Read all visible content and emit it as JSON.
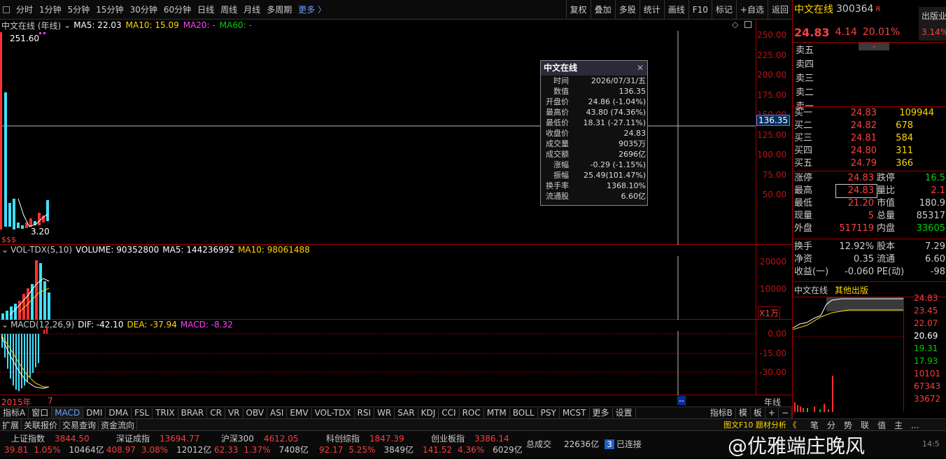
{
  "toolbar": {
    "periods": [
      "分时",
      "1分钟",
      "5分钟",
      "15分钟",
      "30分钟",
      "60分钟",
      "日线",
      "周线",
      "月线",
      "多周期"
    ],
    "more": "更多 〉",
    "right_buttons": [
      "复权",
      "叠加",
      "多股",
      "统计",
      "画线",
      "F10",
      "标记",
      "+自选",
      "返回"
    ]
  },
  "main_chart": {
    "name": "中文在线 (年线)",
    "ma5": "MA5: 22.03",
    "ma10": "MA10: 15.09",
    "ma20": "MA20: -",
    "ma60": "MA60: -",
    "high_label": "251.60",
    "low_label": "3.20",
    "s_marks": "$$$",
    "y_ticks": [
      "250.00",
      "225.00",
      "200.00",
      "175.00",
      "150.00",
      "125.00",
      "100.00",
      "75.00",
      "50.00"
    ],
    "crosshair_value": "136.35"
  },
  "volume_chart": {
    "title": "VOL-TDX(5,10)",
    "volume": "VOLUME: 90352800",
    "ma5": "MA5: 144236992",
    "ma10": "MA10: 98061488",
    "y_ticks": [
      "20000",
      "10000"
    ],
    "unit": "X1万"
  },
  "macd_chart": {
    "title": "MACD(12,26,9)",
    "dif": "DIF: -42.10",
    "dea": "DEA: -37.94",
    "macd": "MACD: -8.32",
    "y_ticks": [
      "0.00",
      "-15.00",
      "-30.00"
    ]
  },
  "x_axis": {
    "start": "2015年",
    "mid": "7",
    "cursor": "--",
    "right_label": "年线"
  },
  "tooltip": {
    "title": "中文在线",
    "close_glyph": "✕",
    "rows": [
      {
        "k": "时间",
        "v": "2026/07/31/五"
      },
      {
        "k": "数值",
        "v": "136.35"
      },
      {
        "k": "开盘价",
        "v": "24.86 (-1.04%)"
      },
      {
        "k": "最高价",
        "v": "43.80 (74.36%)"
      },
      {
        "k": "最低价",
        "v": "18.31 (-27.11%)"
      },
      {
        "k": "收盘价",
        "v": "24.83"
      },
      {
        "k": "成交量",
        "v": "9035万"
      },
      {
        "k": "成交额",
        "v": "2696亿"
      },
      {
        "k": "涨幅",
        "v": "-0.29 (-1.15%)"
      },
      {
        "k": "振幅",
        "v": "25.49(101.47%)"
      },
      {
        "k": "换手率",
        "v": "1368.10%"
      },
      {
        "k": "流通股",
        "v": "6.60亿"
      }
    ]
  },
  "quote": {
    "name": "中文在线",
    "code": "300364",
    "r": "R",
    "price": "24.83",
    "change": "4.14",
    "pct": "20.01%",
    "sector": "出版业",
    "sector_pct": "3.14%",
    "asks": [
      "卖五",
      "卖四",
      "卖三",
      "卖二",
      "卖一"
    ],
    "bids": [
      {
        "l": "买一",
        "p": "24.83",
        "v": "109944"
      },
      {
        "l": "买二",
        "p": "24.82",
        "v": "678"
      },
      {
        "l": "买三",
        "p": "24.81",
        "v": "584"
      },
      {
        "l": "买四",
        "p": "24.80",
        "v": "311"
      },
      {
        "l": "买五",
        "p": "24.79",
        "v": "366"
      }
    ],
    "stats1": [
      {
        "a": "涨停",
        "b": "24.83",
        "c": "跌停",
        "d": "16.5"
      },
      {
        "a": "最高",
        "b": "24.83",
        "c": "量比",
        "d": "2.1"
      },
      {
        "a": "最低",
        "b": "21.20",
        "c": "市值",
        "d": "180.9"
      },
      {
        "a": "现量",
        "b": "5",
        "c": "总量",
        "d": "85317"
      },
      {
        "a": "外盘",
        "b": "517119",
        "c": "内盘",
        "d": "33605"
      }
    ],
    "stats2": [
      {
        "a": "换手",
        "b": "12.92%",
        "c": "股本",
        "d": "7.29"
      },
      {
        "a": "净资",
        "b": "0.35",
        "c": "流通",
        "d": "6.60"
      },
      {
        "a": "收益(一)",
        "b": "-0.060",
        "c": "PE(动)",
        "d": "-98"
      }
    ],
    "mini_tabs": [
      "中文在线",
      "其他出版"
    ],
    "mini_ticks": [
      "24.83",
      "23.45",
      "22.07",
      "20.69",
      "19.31",
      "17.93",
      "10101",
      "67343",
      "33672"
    ]
  },
  "bottom_tabs": [
    "指标A",
    "窗口",
    "MACD",
    "DMI",
    "DMA",
    "FSL",
    "TRIX",
    "BRAR",
    "CR",
    "VR",
    "OBV",
    "ASI",
    "EMV",
    "VOL-TDX",
    "RSI",
    "WR",
    "SAR",
    "KDJ",
    "CCI",
    "ROC",
    "MTM",
    "BOLL",
    "PSY",
    "MCST",
    "更多",
    "设置"
  ],
  "bottom_right": [
    "指标B",
    "模",
    "板",
    "+",
    "−"
  ],
  "sub_tabs": [
    "扩展",
    "关联报价",
    "交易查询",
    "资金流向"
  ],
  "sub_right": "图文F10 题材分析 《",
  "sub_right_icons": [
    "笔",
    "分",
    "势",
    "联",
    "值",
    "主",
    "..."
  ],
  "indices": [
    {
      "name": "上证指数",
      "val": "3844.50",
      "chg": "39.81",
      "pct": "1.05%",
      "amt": "10464亿"
    },
    {
      "name": "深证成指",
      "val": "13694.77",
      "chg": "408.97",
      "pct": "3.08%",
      "amt": "12012亿"
    },
    {
      "name": "沪深300",
      "val": "4612.05",
      "chg": "62.33",
      "pct": "1.37%",
      "amt": "7408亿"
    },
    {
      "name": "科创综指",
      "val": "1847.39",
      "chg": "92.17",
      "pct": "5.25%",
      "amt": "3849亿"
    },
    {
      "name": "创业板指",
      "val": "3386.14",
      "chg": "141.52",
      "pct": "4.36%",
      "amt": "6029亿"
    }
  ],
  "total_label": "总成交",
  "total_value": "22636亿",
  "conn_count": "3",
  "conn_text": "已连接",
  "watermark": "@优雅端庄晚风",
  "time_partial": "14:5"
}
